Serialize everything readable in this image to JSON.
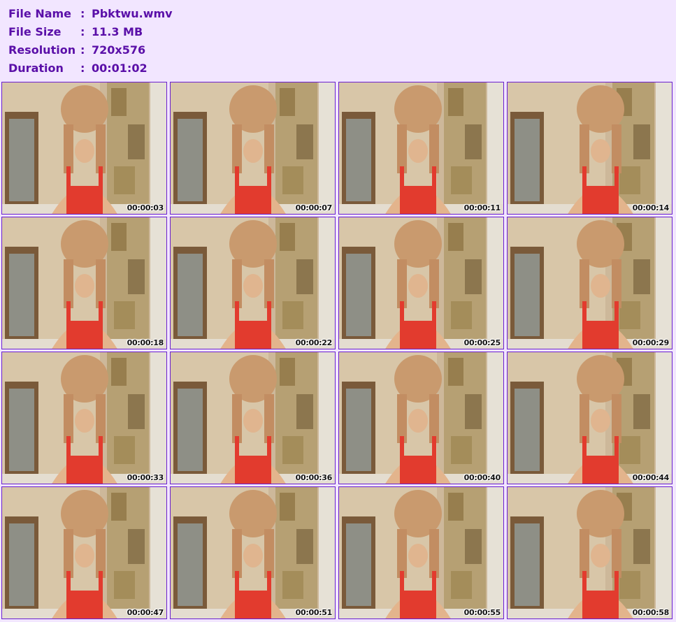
{
  "file_info": [
    {
      "label": "File Name",
      "sep": ":",
      "value": "Pbktwu.wmv"
    },
    {
      "label": "File Size",
      "sep": ":",
      "value": "11.3 MB"
    },
    {
      "label": "Resolution",
      "sep": ":",
      "value": "720x576"
    },
    {
      "label": "Duration",
      "sep": ":",
      "value": "00:01:02"
    }
  ],
  "thumbnails": [
    {
      "timestamp": "00:00:03"
    },
    {
      "timestamp": "00:00:07"
    },
    {
      "timestamp": "00:00:11"
    },
    {
      "timestamp": "00:00:14"
    },
    {
      "timestamp": "00:00:18"
    },
    {
      "timestamp": "00:00:22"
    },
    {
      "timestamp": "00:00:25"
    },
    {
      "timestamp": "00:00:29"
    },
    {
      "timestamp": "00:00:33"
    },
    {
      "timestamp": "00:00:36"
    },
    {
      "timestamp": "00:00:40"
    },
    {
      "timestamp": "00:00:44"
    },
    {
      "timestamp": "00:00:47"
    },
    {
      "timestamp": "00:00:51"
    },
    {
      "timestamp": "00:00:55"
    },
    {
      "timestamp": "00:00:58"
    }
  ],
  "colors": {
    "background": "#f2e6ff",
    "text": "#5a0fa8",
    "thumb_border": "#6a1fd0"
  }
}
